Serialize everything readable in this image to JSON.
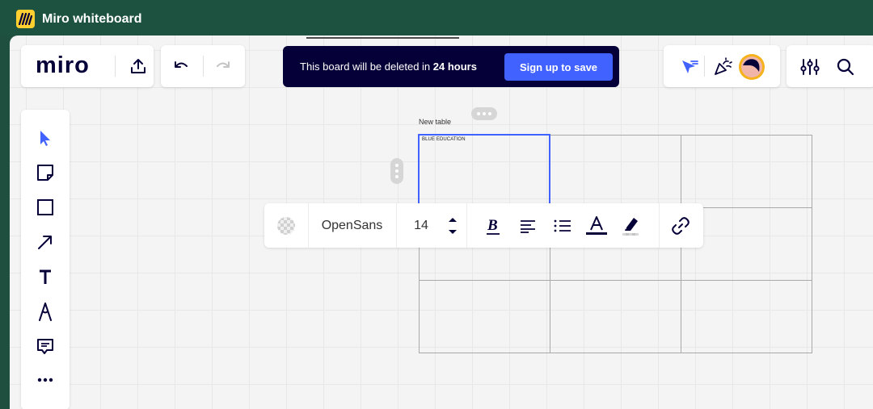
{
  "window": {
    "title": "Miro whiteboard"
  },
  "header": {
    "logo_text": "miro",
    "banner": {
      "text_prefix": "This board will be deleted in ",
      "text_bold": "24 hours",
      "button": "Sign up to save"
    }
  },
  "table": {
    "label": "New table",
    "rows": [
      [
        "BLUE EDUCATION",
        "",
        ""
      ],
      [
        "",
        "",
        ""
      ],
      [
        "",
        "",
        ""
      ]
    ]
  },
  "format_toolbar": {
    "font": "OpenSans",
    "size": "14"
  },
  "icons": {
    "app": "miro-logo-icon",
    "export": "upload-icon",
    "undo": "undo-icon",
    "redo": "redo-icon",
    "cursor": "select-cursor-icon",
    "reactions": "party-popper-icon",
    "settings": "sliders-icon",
    "search": "search-icon",
    "left_tools": [
      "cursor-icon",
      "sticky-note-icon",
      "rectangle-icon",
      "arrow-icon",
      "text-icon",
      "pen-icon",
      "comment-icon",
      "more-icon"
    ]
  },
  "colors": {
    "accent": "#4262ff",
    "title_bar": "#1e5240",
    "banner_bg": "#050038"
  }
}
